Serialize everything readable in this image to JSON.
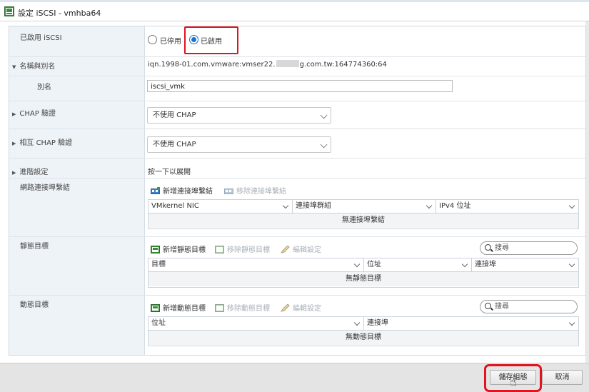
{
  "window": {
    "title": "設定 iSCSI - vmhba64"
  },
  "enable_iscsi": {
    "label": "已啟用 iSCSI",
    "option_disabled": "已停用",
    "option_enabled": "已啟用",
    "selected": "已啟用"
  },
  "name_alias": {
    "label": "名稱與別名",
    "iqn_prefix": "iqn.1998-01.com.vmware:vmser22.",
    "iqn_suffix": "g.com.tw:164774360:64",
    "alias_label": "別名",
    "alias_value": "iscsi_vmk"
  },
  "chap": {
    "label": "CHAP 驗證",
    "value": "不使用 CHAP"
  },
  "mutual_chap": {
    "label": "相互 CHAP 驗證",
    "value": "不使用 CHAP"
  },
  "advanced": {
    "label": "進階設定",
    "value": "按一下以展開"
  },
  "port_bindings": {
    "label": "網路連接埠繫結",
    "add_label": "新增連接埠繫結",
    "remove_label": "移除連接埠繫結",
    "columns": [
      "VMkernel NIC",
      "連接埠群組",
      "IPv4 位址"
    ],
    "empty_text": "無連接埠繫結"
  },
  "static_targets": {
    "label": "靜態目標",
    "add_label": "新增靜態目標",
    "remove_label": "移除靜態目標",
    "edit_label": "編輯設定",
    "search_placeholder": "搜尋",
    "columns": [
      "目標",
      "位址",
      "連接埠"
    ],
    "empty_text": "無靜態目標"
  },
  "dynamic_targets": {
    "label": "動態目標",
    "add_label": "新增動態目標",
    "remove_label": "移除動態目標",
    "edit_label": "編輯設定",
    "search_placeholder": "搜尋",
    "columns": [
      "位址",
      "連接埠"
    ],
    "empty_text": "無動態目標"
  },
  "footer": {
    "save_label": "儲存組態",
    "cancel_label": "取消"
  },
  "colors": {
    "highlight": "#e0141e",
    "radio_selected": "#1a73c8",
    "label_column": "#eef3f8"
  }
}
